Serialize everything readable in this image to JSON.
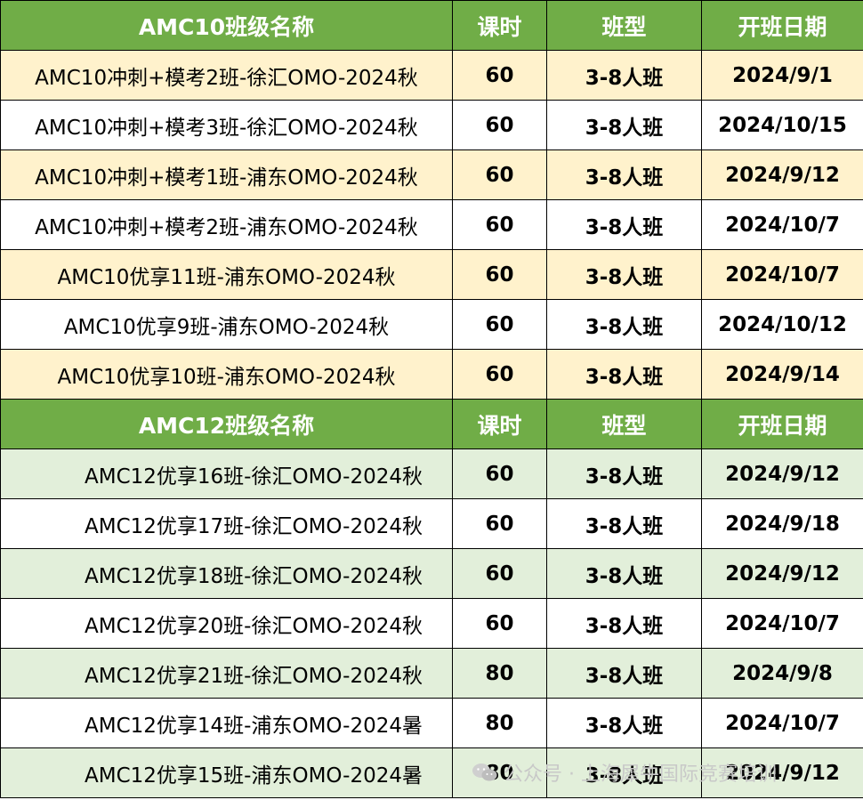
{
  "amc10": {
    "headers": {
      "name": "AMC10班级名称",
      "hours": "课时",
      "type": "班型",
      "start": "开班日期"
    },
    "rows": [
      {
        "name": "AMC10冲刺+模考2班-徐汇OMO-2024秋",
        "hours": "60",
        "type": "3-8人班",
        "start": "2024/9/1"
      },
      {
        "name": "AMC10冲刺+模考3班-徐汇OMO-2024秋",
        "hours": "60",
        "type": "3-8人班",
        "start": "2024/10/15"
      },
      {
        "name": "AMC10冲刺+模考1班-浦东OMO-2024秋",
        "hours": "60",
        "type": "3-8人班",
        "start": "2024/9/12"
      },
      {
        "name": "AMC10冲刺+模考2班-浦东OMO-2024秋",
        "hours": "60",
        "type": "3-8人班",
        "start": "2024/10/7"
      },
      {
        "name": "AMC10优享11班-浦东OMO-2024秋",
        "hours": "60",
        "type": "3-8人班",
        "start": "2024/10/7"
      },
      {
        "name": "AMC10优享9班-浦东OMO-2024秋",
        "hours": "60",
        "type": "3-8人班",
        "start": "2024/10/12"
      },
      {
        "name": "AMC10优享10班-浦东OMO-2024秋",
        "hours": "60",
        "type": "3-8人班",
        "start": "2024/9/14"
      }
    ]
  },
  "amc12": {
    "headers": {
      "name": "AMC12班级名称",
      "hours": "课时",
      "type": "班型",
      "start": "开班日期"
    },
    "rows": [
      {
        "name": "AMC12优享16班-徐汇OMO-2024秋",
        "hours": "60",
        "type": "3-8人班",
        "start": "2024/9/12"
      },
      {
        "name": "AMC12优享17班-徐汇OMO-2024秋",
        "hours": "60",
        "type": "3-8人班",
        "start": "2024/9/18"
      },
      {
        "name": "AMC12优享18班-徐汇OMO-2024秋",
        "hours": "60",
        "type": "3-8人班",
        "start": "2024/9/12"
      },
      {
        "name": "AMC12优享20班-徐汇OMO-2024秋",
        "hours": "60",
        "type": "3-8人班",
        "start": "2024/10/7"
      },
      {
        "name": "AMC12优享21班-徐汇OMO-2024秋",
        "hours": "80",
        "type": "3-8人班",
        "start": "2024/9/8"
      },
      {
        "name": "AMC12优享14班-浦东OMO-2024暑",
        "hours": "80",
        "type": "3-8人班",
        "start": "2024/10/7"
      },
      {
        "name": "AMC12优享15班-浦东OMO-2024暑",
        "hours": "80",
        "type": "3-8人班",
        "start": "2024/9/12"
      }
    ]
  },
  "watermark": {
    "icon": "wechat-icon",
    "text": "公众号 · 上海犀牛国际竞赛培训"
  },
  "colors": {
    "header": "#70ad47",
    "amc10_alt": "#fff2cc",
    "amc12_alt": "#e2efda"
  }
}
